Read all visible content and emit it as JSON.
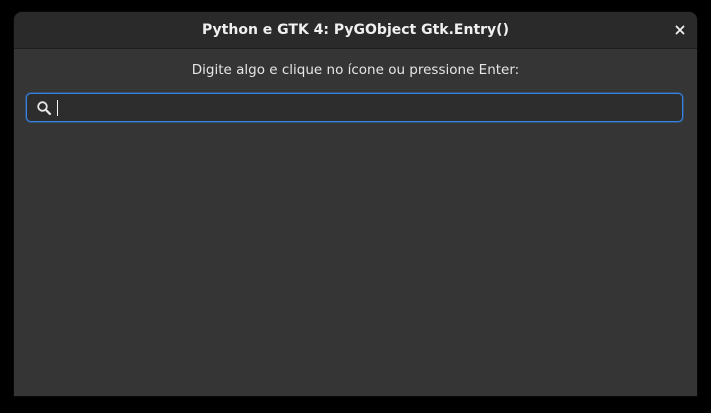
{
  "window": {
    "title": "Python e GTK 4: PyGObject Gtk.Entry()",
    "close_icon": "close-icon"
  },
  "main": {
    "instruction": "Digite algo e clique no ícone ou pressione Enter:",
    "entry": {
      "value": "",
      "placeholder": "",
      "icon": "search-icon"
    }
  },
  "colors": {
    "window_bg": "#353535",
    "headerbar_bg": "#2a2a2a",
    "accent": "#3584e4",
    "text": "#ffffff"
  }
}
